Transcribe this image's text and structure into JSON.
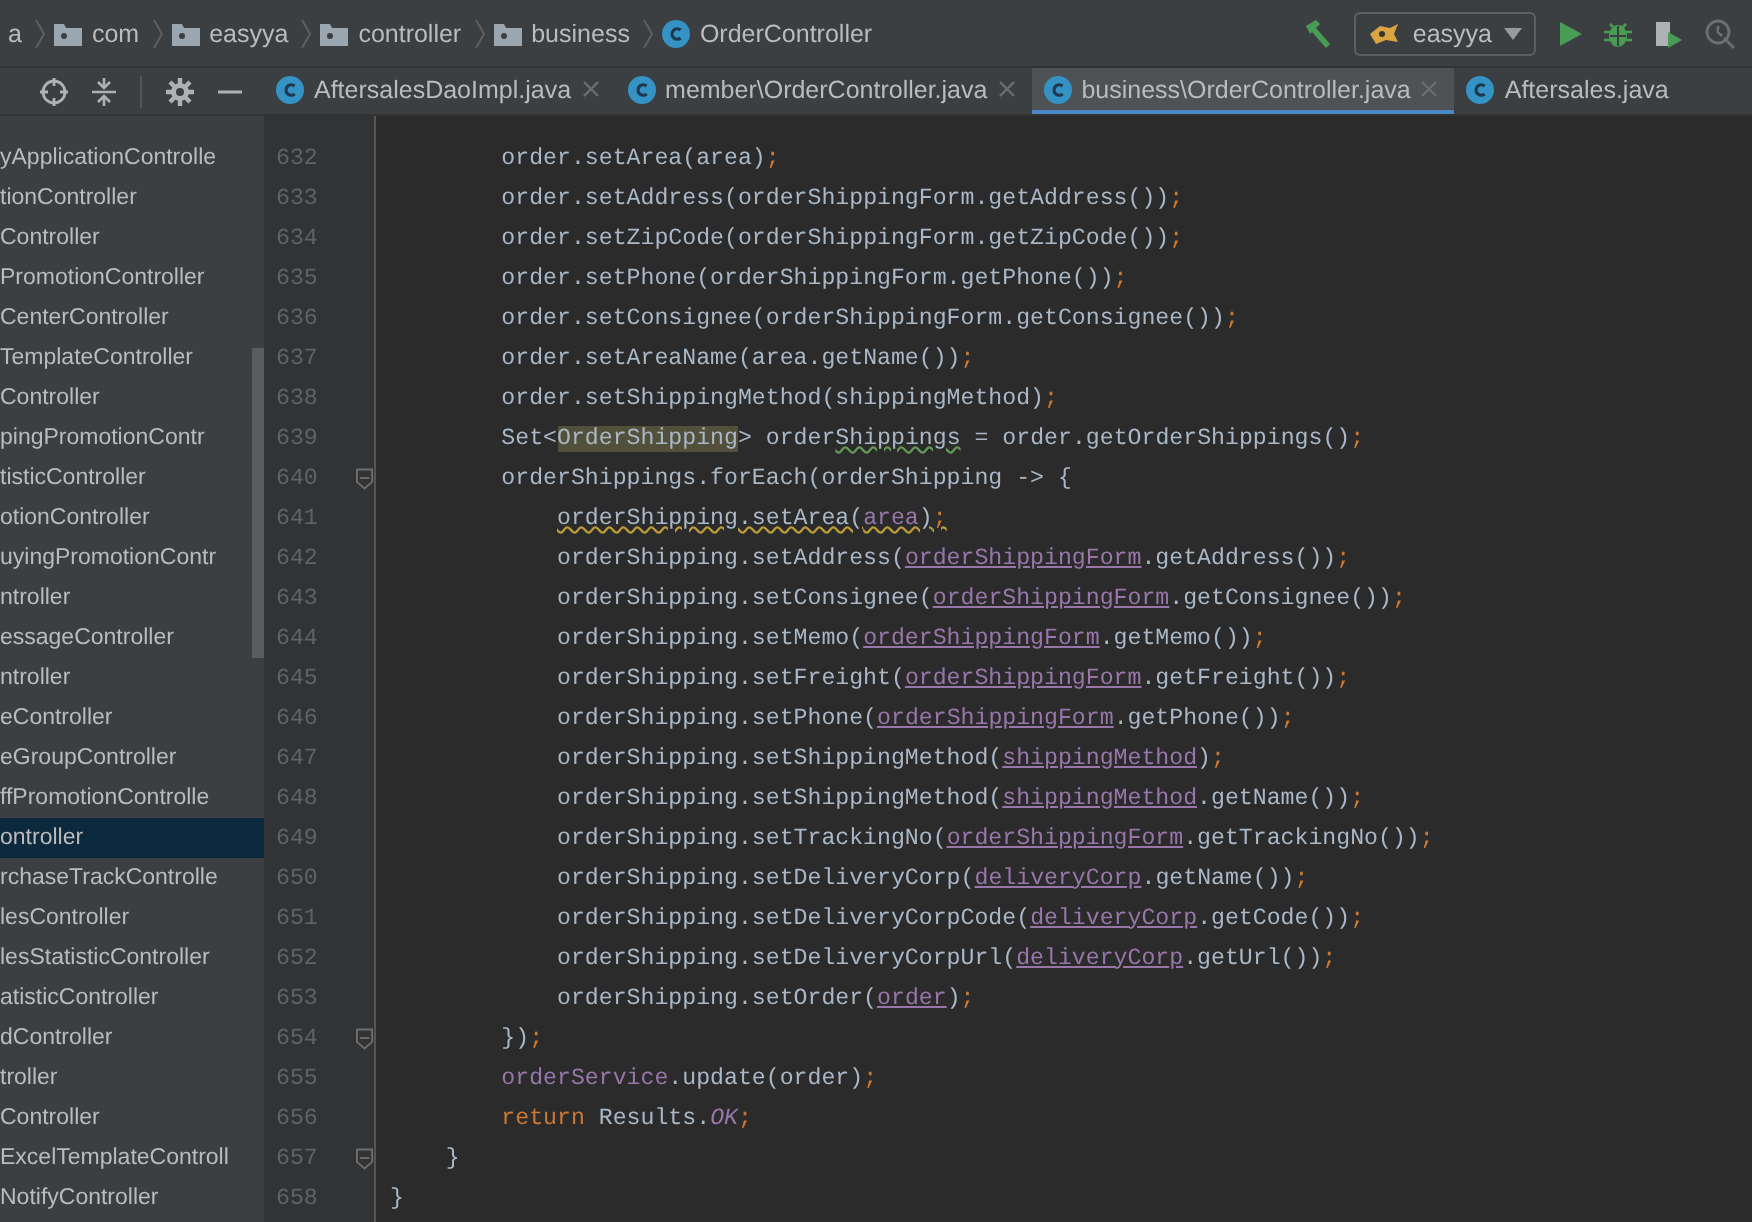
{
  "breadcrumbs": [
    {
      "label": "a",
      "kind": "text"
    },
    {
      "label": "com",
      "kind": "folder"
    },
    {
      "label": "easyya",
      "kind": "folder"
    },
    {
      "label": "controller",
      "kind": "folder"
    },
    {
      "label": "business",
      "kind": "folder"
    },
    {
      "label": "OrderController",
      "kind": "class"
    }
  ],
  "run_config": {
    "label": "easyya"
  },
  "tabs": [
    {
      "label": "AftersalesDaoImpl.java",
      "selected": false,
      "closable": true
    },
    {
      "label": "member\\OrderController.java",
      "selected": false,
      "closable": true
    },
    {
      "label": "business\\OrderController.java",
      "selected": true,
      "closable": true
    },
    {
      "label": "Aftersales.java",
      "selected": false,
      "closable": false
    }
  ],
  "project_tree": [
    {
      "label": "yApplicationControlle",
      "selected": false
    },
    {
      "label": "tionController",
      "selected": false
    },
    {
      "label": "Controller",
      "selected": false
    },
    {
      "label": "PromotionController",
      "selected": false
    },
    {
      "label": "CenterController",
      "selected": false
    },
    {
      "label": "TemplateController",
      "selected": false
    },
    {
      "label": "Controller",
      "selected": false
    },
    {
      "label": "pingPromotionContr",
      "selected": false
    },
    {
      "label": "tisticController",
      "selected": false
    },
    {
      "label": "otionController",
      "selected": false
    },
    {
      "label": "uyingPromotionContr",
      "selected": false
    },
    {
      "label": "ntroller",
      "selected": false
    },
    {
      "label": "essageController",
      "selected": false
    },
    {
      "label": "ntroller",
      "selected": false
    },
    {
      "label": "eController",
      "selected": false
    },
    {
      "label": "eGroupController",
      "selected": false
    },
    {
      "label": "ffPromotionControlle",
      "selected": false
    },
    {
      "label": "ontroller",
      "selected": true
    },
    {
      "label": "rchaseTrackControlle",
      "selected": false
    },
    {
      "label": "lesController",
      "selected": false
    },
    {
      "label": "lesStatisticController",
      "selected": false
    },
    {
      "label": "atisticController",
      "selected": false
    },
    {
      "label": "dController",
      "selected": false
    },
    {
      "label": "troller",
      "selected": false
    },
    {
      "label": "Controller",
      "selected": false
    },
    {
      "label": "ExcelTemplateControll",
      "selected": false
    },
    {
      "label": "NotifyController",
      "selected": false
    }
  ],
  "code_lines": [
    {
      "number": "632",
      "fold": false,
      "segments": [
        {
          "text": "        order.setArea(area)",
          "kind": "text"
        },
        {
          "text": ";",
          "kind": "semicolon"
        }
      ]
    },
    {
      "number": "633",
      "fold": false,
      "segments": [
        {
          "text": "        order.setAddress(orderShippingForm.getAddress())",
          "kind": "text"
        },
        {
          "text": ";",
          "kind": "semicolon"
        }
      ]
    },
    {
      "number": "634",
      "fold": false,
      "segments": [
        {
          "text": "        order.setZipCode(orderShippingForm.getZipCode())",
          "kind": "text"
        },
        {
          "text": ";",
          "kind": "semicolon"
        }
      ]
    },
    {
      "number": "635",
      "fold": false,
      "segments": [
        {
          "text": "        order.setPhone(orderShippingForm.getPhone())",
          "kind": "text"
        },
        {
          "text": ";",
          "kind": "semicolon"
        }
      ]
    },
    {
      "number": "636",
      "fold": false,
      "segments": [
        {
          "text": "        order.setConsignee(orderShippingForm.getConsignee())",
          "kind": "text"
        },
        {
          "text": ";",
          "kind": "semicolon"
        }
      ]
    },
    {
      "number": "637",
      "fold": false,
      "segments": [
        {
          "text": "        order.setAreaName(area.getName())",
          "kind": "text"
        },
        {
          "text": ";",
          "kind": "semicolon"
        }
      ]
    },
    {
      "number": "638",
      "fold": false,
      "segments": [
        {
          "text": "        order.setShippingMethod(shippingMethod)",
          "kind": "text"
        },
        {
          "text": ";",
          "kind": "semicolon"
        }
      ]
    },
    {
      "number": "639",
      "fold": false,
      "segments": [
        {
          "text": "        Set<",
          "kind": "text"
        },
        {
          "text": "OrderShipping",
          "kind": "highlight"
        },
        {
          "text": "> order",
          "kind": "text"
        },
        {
          "text": "Shippings",
          "kind": "typo"
        },
        {
          "text": " = order.getOrderShippings()",
          "kind": "text"
        },
        {
          "text": ";",
          "kind": "semicolon"
        }
      ]
    },
    {
      "number": "640",
      "fold": true,
      "segments": [
        {
          "text": "        orderShippings.forEach(orderShipping -> {",
          "kind": "text"
        }
      ]
    },
    {
      "number": "641",
      "fold": false,
      "segments": [
        {
          "text": "            orderShipping.setArea(",
          "kind": "warning"
        },
        {
          "text": "area",
          "kind": "warning-captured"
        },
        {
          "text": ")",
          "kind": "warning"
        },
        {
          "text": ";",
          "kind": "warning-semicolon"
        }
      ]
    },
    {
      "number": "642",
      "fold": false,
      "segments": [
        {
          "text": "            orderShipping.setAddress(",
          "kind": "text"
        },
        {
          "text": "orderShippingForm",
          "kind": "captured"
        },
        {
          "text": ".getAddress())",
          "kind": "text"
        },
        {
          "text": ";",
          "kind": "semicolon"
        }
      ]
    },
    {
      "number": "643",
      "fold": false,
      "segments": [
        {
          "text": "            orderShipping.setConsignee(",
          "kind": "text"
        },
        {
          "text": "orderShippingForm",
          "kind": "captured"
        },
        {
          "text": ".getConsignee())",
          "kind": "text"
        },
        {
          "text": ";",
          "kind": "semicolon"
        }
      ]
    },
    {
      "number": "644",
      "fold": false,
      "segments": [
        {
          "text": "            orderShipping.setMemo(",
          "kind": "text"
        },
        {
          "text": "orderShippingForm",
          "kind": "captured"
        },
        {
          "text": ".getMemo())",
          "kind": "text"
        },
        {
          "text": ";",
          "kind": "semicolon"
        }
      ]
    },
    {
      "number": "645",
      "fold": false,
      "segments": [
        {
          "text": "            orderShipping.setFreight(",
          "kind": "text"
        },
        {
          "text": "orderShippingForm",
          "kind": "captured"
        },
        {
          "text": ".getFreight())",
          "kind": "text"
        },
        {
          "text": ";",
          "kind": "semicolon"
        }
      ]
    },
    {
      "number": "646",
      "fold": false,
      "segments": [
        {
          "text": "            orderShipping.setPhone(",
          "kind": "text"
        },
        {
          "text": "orderShippingForm",
          "kind": "captured"
        },
        {
          "text": ".getPhone())",
          "kind": "text"
        },
        {
          "text": ";",
          "kind": "semicolon"
        }
      ]
    },
    {
      "number": "647",
      "fold": false,
      "segments": [
        {
          "text": "            orderShipping.setShippingMethod(",
          "kind": "text"
        },
        {
          "text": "shippingMethod",
          "kind": "captured"
        },
        {
          "text": ")",
          "kind": "text"
        },
        {
          "text": ";",
          "kind": "semicolon"
        }
      ]
    },
    {
      "number": "648",
      "fold": false,
      "segments": [
        {
          "text": "            orderShipping.setShippingMethod(",
          "kind": "text"
        },
        {
          "text": "shippingMethod",
          "kind": "captured"
        },
        {
          "text": ".getName())",
          "kind": "text"
        },
        {
          "text": ";",
          "kind": "semicolon"
        }
      ]
    },
    {
      "number": "649",
      "fold": false,
      "segments": [
        {
          "text": "            orderShipping.setTrackingNo(",
          "kind": "text"
        },
        {
          "text": "orderShippingForm",
          "kind": "captured"
        },
        {
          "text": ".getTrackingNo())",
          "kind": "text"
        },
        {
          "text": ";",
          "kind": "semicolon"
        }
      ]
    },
    {
      "number": "650",
      "fold": false,
      "segments": [
        {
          "text": "            orderShipping.setDeliveryCorp(",
          "kind": "text"
        },
        {
          "text": "deliveryCorp",
          "kind": "captured"
        },
        {
          "text": ".getName())",
          "kind": "text"
        },
        {
          "text": ";",
          "kind": "semicolon"
        }
      ]
    },
    {
      "number": "651",
      "fold": false,
      "segments": [
        {
          "text": "            orderShipping.setDeliveryCorpCode(",
          "kind": "text"
        },
        {
          "text": "deliveryCorp",
          "kind": "captured"
        },
        {
          "text": ".getCode())",
          "kind": "text"
        },
        {
          "text": ";",
          "kind": "semicolon"
        }
      ]
    },
    {
      "number": "652",
      "fold": false,
      "segments": [
        {
          "text": "            orderShipping.setDeliveryCorpUrl(",
          "kind": "text"
        },
        {
          "text": "deliveryCorp",
          "kind": "captured"
        },
        {
          "text": ".getUrl())",
          "kind": "text"
        },
        {
          "text": ";",
          "kind": "semicolon"
        }
      ]
    },
    {
      "number": "653",
      "fold": false,
      "segments": [
        {
          "text": "            orderShipping.setOrder(",
          "kind": "text"
        },
        {
          "text": "order",
          "kind": "captured"
        },
        {
          "text": ")",
          "kind": "text"
        },
        {
          "text": ";",
          "kind": "semicolon"
        }
      ]
    },
    {
      "number": "654",
      "fold": true,
      "segments": [
        {
          "text": "        })",
          "kind": "text"
        },
        {
          "text": ";",
          "kind": "semicolon"
        }
      ]
    },
    {
      "number": "655",
      "fold": false,
      "segments": [
        {
          "text": "        orderService",
          "kind": "field"
        },
        {
          "text": ".update(order)",
          "kind": "text"
        },
        {
          "text": ";",
          "kind": "semicolon"
        }
      ]
    },
    {
      "number": "656",
      "fold": false,
      "segments": [
        {
          "text": "        return",
          "kind": "keyword"
        },
        {
          "text": " Results.",
          "kind": "text"
        },
        {
          "text": "OK",
          "kind": "constant"
        },
        {
          "text": ";",
          "kind": "semicolon"
        }
      ]
    },
    {
      "number": "657",
      "fold": true,
      "segments": [
        {
          "text": "    }",
          "kind": "text"
        }
      ]
    },
    {
      "number": "658",
      "fold": false,
      "segments": [
        {
          "text": "}",
          "kind": "text"
        }
      ]
    }
  ]
}
